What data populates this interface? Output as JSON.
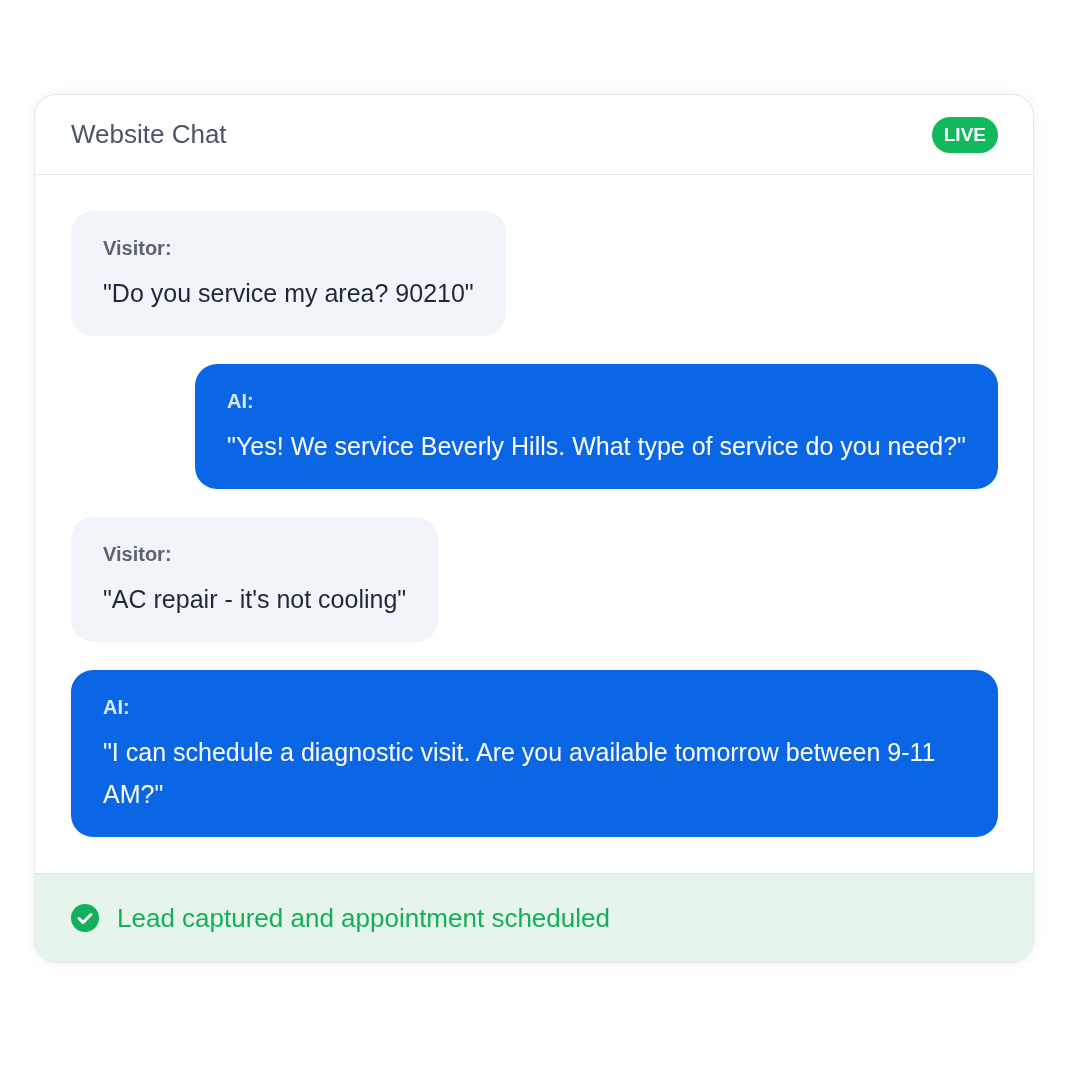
{
  "chat": {
    "title": "Website Chat",
    "badge": "LIVE"
  },
  "messages": [
    {
      "kind": "visitor",
      "label": "Visitor:",
      "text": "\"Do you service my area? 90210\""
    },
    {
      "kind": "ai",
      "label": "AI:",
      "text": "\"Yes! We service Beverly Hills. What type of service do you need?\""
    },
    {
      "kind": "visitor",
      "label": "Visitor:",
      "text": "\"AC repair - it's not cooling\""
    },
    {
      "kind": "ai",
      "label": "AI:",
      "text": "\"I can schedule a diagnostic visit. Are you available tomorrow between 9-11 AM?\""
    }
  ],
  "footer": {
    "text": "Lead captured and appointment scheduled"
  }
}
